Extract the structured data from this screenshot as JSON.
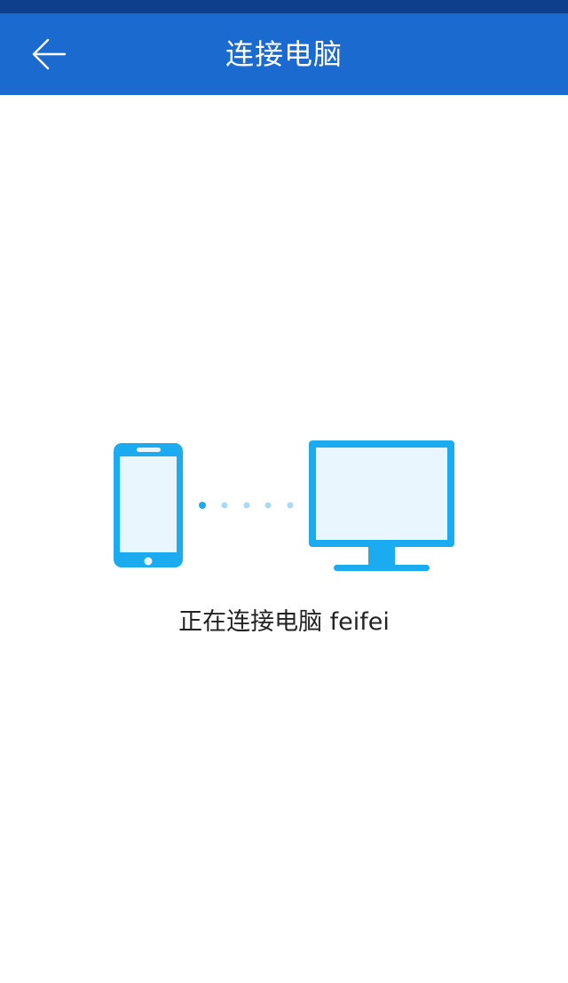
{
  "app_bar": {
    "title": "连接电脑",
    "back_icon": "arrow-left-icon"
  },
  "main": {
    "status_text": "正在连接电脑 feifei",
    "phone_icon": "smartphone-icon",
    "computer_icon": "monitor-icon"
  },
  "colors": {
    "app_bar": "#1a6ad0",
    "status_bar": "#0d3f8a",
    "accent": "#1aabf0",
    "screen_fill": "#eaf6fd",
    "text": "#222222"
  }
}
